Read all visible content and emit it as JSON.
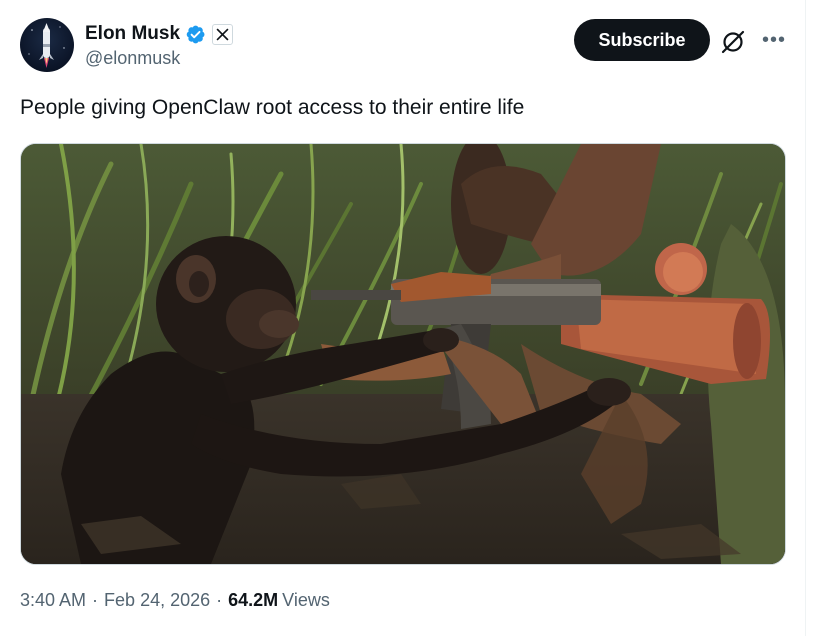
{
  "author": {
    "name": "Elon Musk",
    "handle": "@elonmusk",
    "verified": true,
    "affiliation_badge": "x-logo-icon"
  },
  "actions": {
    "subscribe_label": "Subscribe",
    "grok_icon": "grok-icon",
    "more_icon": "more-options-icon"
  },
  "tweet": {
    "text": "People giving OpenClaw root access to their entire life"
  },
  "meta": {
    "time": "3:40 AM",
    "date": "Feb 24, 2026",
    "views_count": "64.2M",
    "views_label": "Views"
  },
  "colors": {
    "primary_text": "#0f1419",
    "secondary_text": "#536471",
    "verified_blue": "#1d9bf0",
    "button_bg": "#0f1419",
    "border": "#cfd9de"
  }
}
